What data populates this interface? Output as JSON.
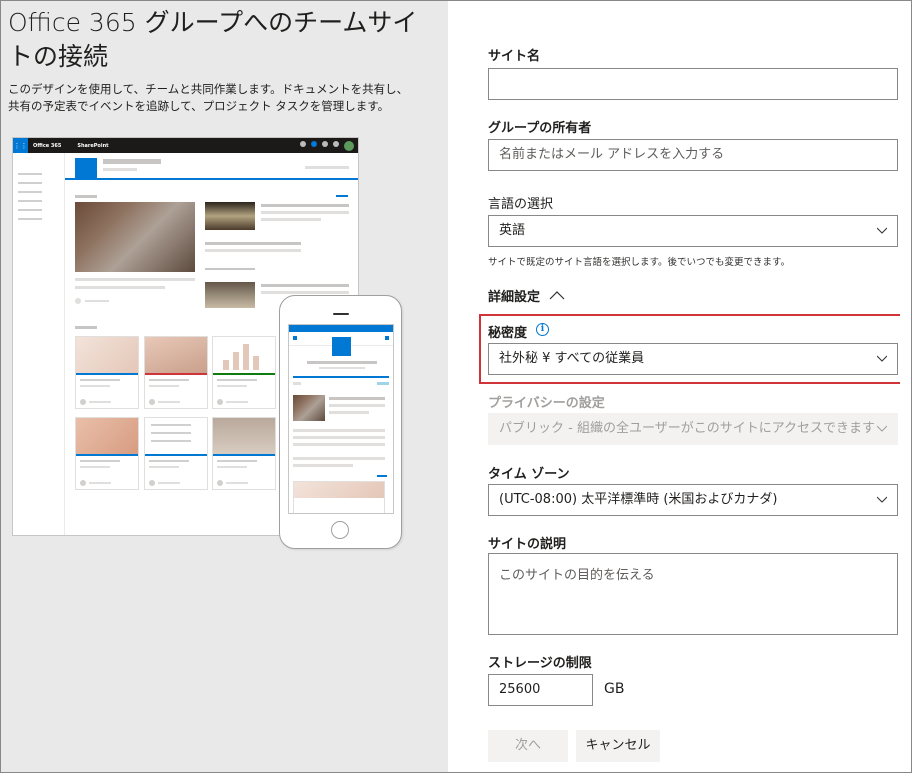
{
  "left": {
    "title": "Office 365 グループへのチームサイトの接続",
    "description": "このデザインを使用して、チームと共同作業します。ドキュメントを共有し、共有の予定表でイベントを追跡して、プロジェクト タスクを管理します。",
    "preview": {
      "brand": "Office 365",
      "app": "SharePoint"
    }
  },
  "form": {
    "site_name": {
      "label": "サイト名",
      "value": ""
    },
    "group_owner": {
      "label": "グループの所有者",
      "placeholder": "名前またはメール アドレスを入力する"
    },
    "language": {
      "label": "言語の選択",
      "value": "英語",
      "hint": "サイトで既定のサイト言語を選択します。後でいつでも変更できます。"
    },
    "advanced": {
      "label": "詳細設定",
      "icon": "chevron-up-icon"
    },
    "sensitivity": {
      "label": "秘密度",
      "icon": "info-icon",
      "info_glyph": "i",
      "value": "社外秘 ¥ すべての従業員"
    },
    "privacy": {
      "label": "プライバシーの設定",
      "value": "パブリック - 組織の全ユーザーがこのサイトにアクセスできます"
    },
    "timezone": {
      "label": "タイム ゾーン",
      "value": "(UTC-08:00) 太平洋標準時 (米国およびカナダ)"
    },
    "description": {
      "label": "サイトの説明",
      "placeholder": "このサイトの目的を伝える"
    },
    "storage": {
      "label": "ストレージの制限",
      "value": "25600",
      "unit": "GB"
    }
  },
  "buttons": {
    "next": "次へ",
    "cancel": "キャンセル"
  },
  "colors": {
    "accent": "#0078d4",
    "highlight_border": "#d13438",
    "left_panel_bg": "#e9e9e9"
  }
}
